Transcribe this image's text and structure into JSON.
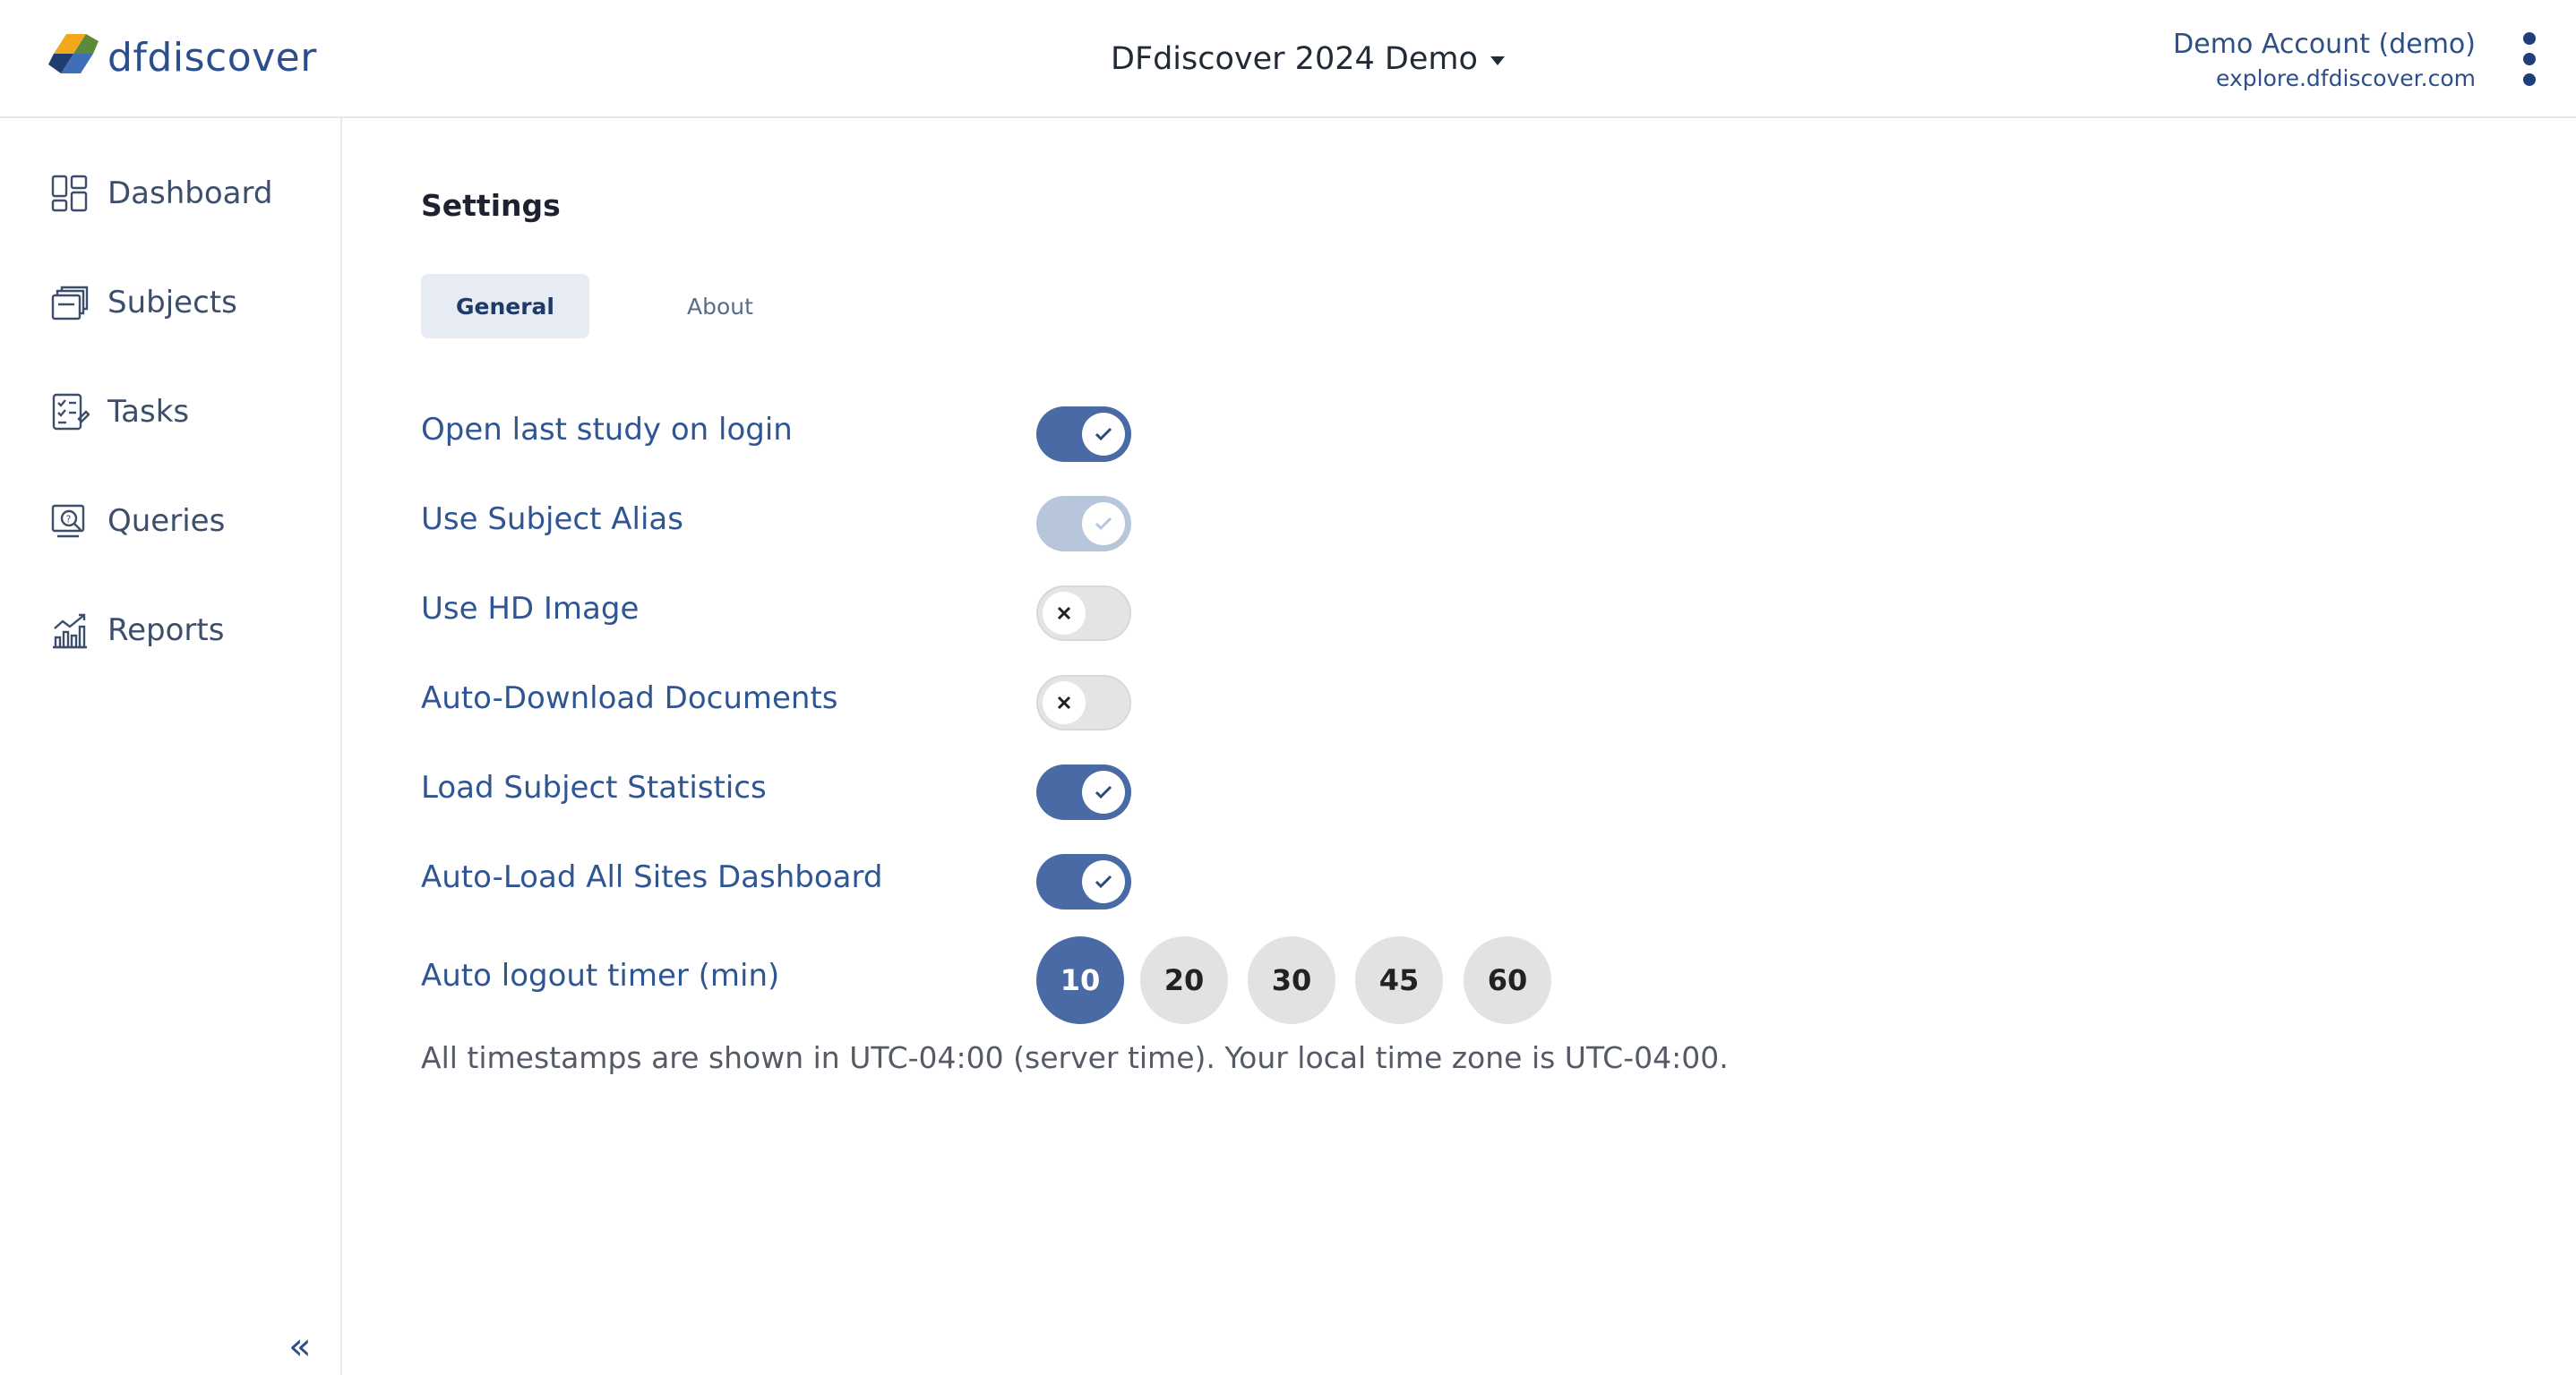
{
  "header": {
    "logo_text": "dfdiscover",
    "study_title": "DFdiscover 2024 Demo",
    "account_name": "Demo Account (demo)",
    "account_host": "explore.dfdiscover.com"
  },
  "sidebar": {
    "items": [
      {
        "label": "Dashboard",
        "icon": "dashboard-icon"
      },
      {
        "label": "Subjects",
        "icon": "subjects-icon"
      },
      {
        "label": "Tasks",
        "icon": "tasks-icon"
      },
      {
        "label": "Queries",
        "icon": "queries-icon"
      },
      {
        "label": "Reports",
        "icon": "reports-icon"
      }
    ],
    "collapse_glyph": "«"
  },
  "main": {
    "title": "Settings",
    "tabs": [
      {
        "label": "General",
        "active": true
      },
      {
        "label": "About",
        "active": false
      }
    ],
    "settings": [
      {
        "label": "Open last study on login",
        "state": "on"
      },
      {
        "label": "Use Subject Alias",
        "state": "on-disabled"
      },
      {
        "label": "Use HD Image",
        "state": "off"
      },
      {
        "label": "Auto-Download Documents",
        "state": "off"
      },
      {
        "label": "Load Subject Statistics",
        "state": "on"
      },
      {
        "label": "Auto-Load All Sites Dashboard",
        "state": "on"
      }
    ],
    "timer": {
      "label": "Auto logout timer (min)",
      "options": [
        "10",
        "20",
        "30",
        "45",
        "60"
      ],
      "selected": "10"
    },
    "timezone_note": "All timestamps are shown in UTC-04:00 (server time). Your local time zone is UTC-04:00."
  },
  "colors": {
    "accent": "#4a6aa5",
    "toggle_off": "#e4e4e4",
    "toggle_disabled": "#b8c6dc",
    "label_blue": "#2f5592"
  }
}
